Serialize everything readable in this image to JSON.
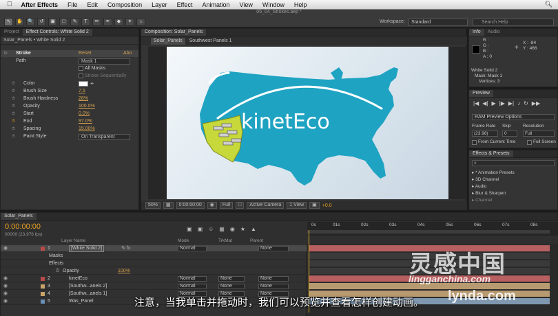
{
  "menubar": {
    "apple": "",
    "app": "After Effects",
    "items": [
      "File",
      "Edit",
      "Composition",
      "Layer",
      "Effect",
      "Animation",
      "View",
      "Window",
      "Help"
    ]
  },
  "toolbar": {
    "doc_title": "05_04_Strokes.aep *",
    "tools": [
      "↖",
      "✋",
      "🔍",
      "↺",
      "▣",
      "□",
      "✎",
      "T",
      "✏",
      "✒",
      "◆",
      "✦",
      "⌂"
    ],
    "workspace_label": "Workspace:",
    "workspace_value": "Standard",
    "search_placeholder": "Search Help"
  },
  "effect_panel": {
    "tabs": [
      "Project",
      "Effect Controls: White Solid 2"
    ],
    "header": "Solar_Panels • White Solid 2",
    "fx_name": "Stroke",
    "reset": "Reset",
    "about": "Abo",
    "path_label": "Path",
    "path_value": "Mask 1",
    "all_masks": "All Masks",
    "stroke_seq": "Stroke Sequentially",
    "rows": [
      {
        "label": "Color",
        "value": ""
      },
      {
        "label": "Brush Size",
        "value": "7.5"
      },
      {
        "label": "Brush Hardness",
        "value": "28%"
      },
      {
        "label": "Opacity",
        "value": "100.0%"
      },
      {
        "label": "Start",
        "value": "0.0%"
      },
      {
        "label": "End",
        "value": "97.0%"
      },
      {
        "label": "Spacing",
        "value": "15.00%"
      }
    ],
    "paint_style_label": "Paint Style",
    "paint_style_value": "On Transparent"
  },
  "comp_panel": {
    "tabs": [
      "Composition: Solar_Panels"
    ],
    "breadcrumbs": [
      "Solar_Panels",
      "Southwest Panels 1"
    ],
    "logo_text": "kinetEco",
    "bar": {
      "zoom": "50%",
      "timecode": "0:00:00:00",
      "resolution": "Full",
      "camera": "Active Camera",
      "views": "1 View",
      "exposure": "+0.0"
    }
  },
  "info_panel": {
    "tabs": [
      "Info",
      "Audio"
    ],
    "r": "R :",
    "g": "G :",
    "b": "B :",
    "a": "A : 0",
    "x": "X : -84",
    "y": "Y : 466",
    "layer": "White Solid 2",
    "mask": "Mask: Mask 1",
    "vertices": "Vertices: 3"
  },
  "preview_panel": {
    "tabs": [
      "Preview"
    ],
    "ram_preview": "RAM Preview Options",
    "frame_rate_label": "Frame Rate",
    "skip_label": "Skip",
    "resolution_label": "Resolution",
    "frame_rate": "(23.98)",
    "skip": "0",
    "resolution": "Full",
    "from_current": "From Current Time",
    "full_screen": "Full Screen"
  },
  "presets_panel": {
    "tabs": [
      "Effects & Presets"
    ],
    "search": "⌕",
    "items": [
      "* Animation Presets",
      "3D Channel",
      "Audio",
      "Blur & Sharpen",
      "Channel"
    ]
  },
  "timeline": {
    "tab": "Solar_Panels",
    "timecode": "0:00:00:00",
    "fps": "00000 (23.976 fps)",
    "ruler": [
      "0s",
      "01s",
      "02s",
      "03s",
      "04s",
      "05s",
      "06s",
      "07s",
      "08s"
    ],
    "col_layer_name": "Layer Name",
    "col_mode": "Mode",
    "col_trkmat": "TrkMat",
    "col_parent": "Parent",
    "layers": [
      {
        "num": "1",
        "name": "[White Solid 2]",
        "mode": "Normal",
        "trkmat": "",
        "parent": "None",
        "color": "#b84a4a",
        "bar": "#b86060"
      },
      {
        "num": "",
        "name": "Masks",
        "mode": "",
        "trkmat": "",
        "parent": "",
        "color": "",
        "bar": ""
      },
      {
        "num": "",
        "name": "Effects",
        "mode": "",
        "trkmat": "",
        "parent": "",
        "color": "",
        "bar": ""
      },
      {
        "num": "",
        "name": "Opacity",
        "value": "100%",
        "mode": "",
        "trkmat": "",
        "parent": "",
        "color": "",
        "bar": ""
      },
      {
        "num": "2",
        "name": "kinetEco",
        "mode": "Normal",
        "trkmat": "None",
        "parent": "None",
        "color": "#b84a4a",
        "bar": "#b86060"
      },
      {
        "num": "3",
        "name": "[Southw...anels 2]",
        "mode": "Normal",
        "trkmat": "None",
        "parent": "None",
        "color": "#c9a46a",
        "bar": "#b89a70"
      },
      {
        "num": "4",
        "name": "[Southw...anels 1]",
        "mode": "Normal",
        "trkmat": "None",
        "parent": "None",
        "color": "#c9a46a",
        "bar": "#b89a70"
      },
      {
        "num": "5",
        "name": "Was_Panel",
        "mode": "Normal",
        "trkmat": "None",
        "parent": "None",
        "color": "#6a90b8",
        "bar": "#7f98b0"
      }
    ]
  },
  "overlay": {
    "subtitle": "注意，当我单击并拖动时，我们可以预览并查看怎样创建动画。",
    "watermark_cn": "灵感中国",
    "watermark_site": "lingganchina.com",
    "watermark_lynda": "lynda.com"
  },
  "colors": {
    "map": "#1fa3c2",
    "highlight": "#c7d83a",
    "accent_orange": "#e8a020"
  }
}
